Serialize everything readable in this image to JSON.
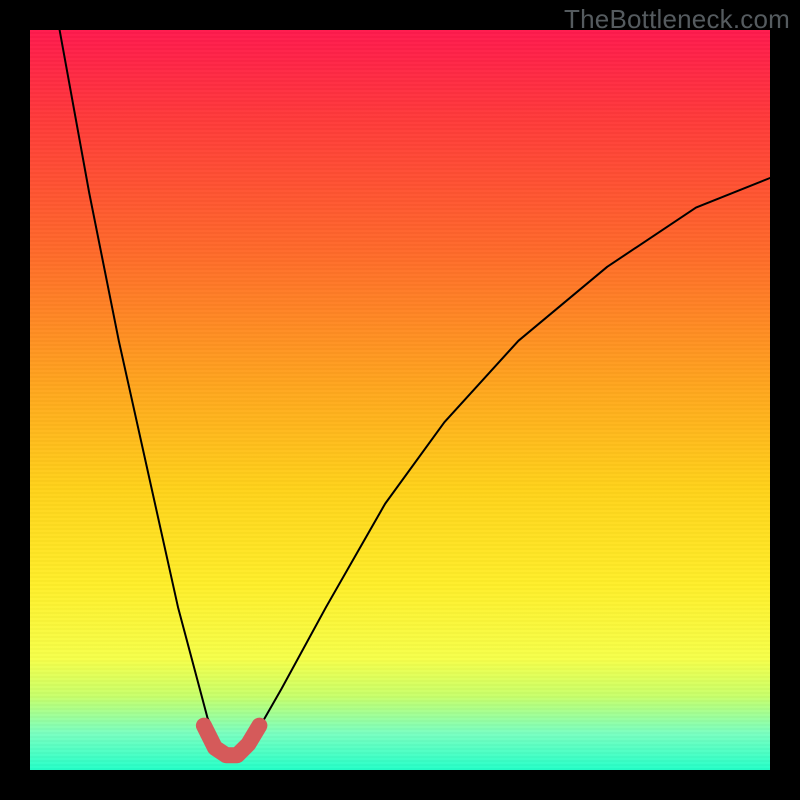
{
  "watermark": "TheBottleneck.com",
  "chart_data": {
    "type": "line",
    "title": "",
    "xlabel": "",
    "ylabel": "",
    "xlim": [
      0,
      1
    ],
    "ylim": [
      0,
      1
    ],
    "grid": false,
    "legend": false,
    "series": [
      {
        "name": "main-curve",
        "color": "#000000",
        "stroke_width": 2,
        "x": [
          0.04,
          0.08,
          0.12,
          0.16,
          0.2,
          0.24,
          0.265,
          0.28,
          0.3,
          0.34,
          0.4,
          0.48,
          0.56,
          0.66,
          0.78,
          0.9,
          1.0
        ],
        "y": [
          1.0,
          0.78,
          0.58,
          0.4,
          0.22,
          0.07,
          0.02,
          0.02,
          0.04,
          0.11,
          0.22,
          0.36,
          0.47,
          0.58,
          0.68,
          0.76,
          0.8
        ]
      },
      {
        "name": "highlight-segment",
        "color": "#d55a5a",
        "stroke_width": 16,
        "x": [
          0.235,
          0.25,
          0.265,
          0.28,
          0.295,
          0.31
        ],
        "y": [
          0.06,
          0.03,
          0.02,
          0.02,
          0.035,
          0.06
        ]
      }
    ],
    "annotations": []
  }
}
